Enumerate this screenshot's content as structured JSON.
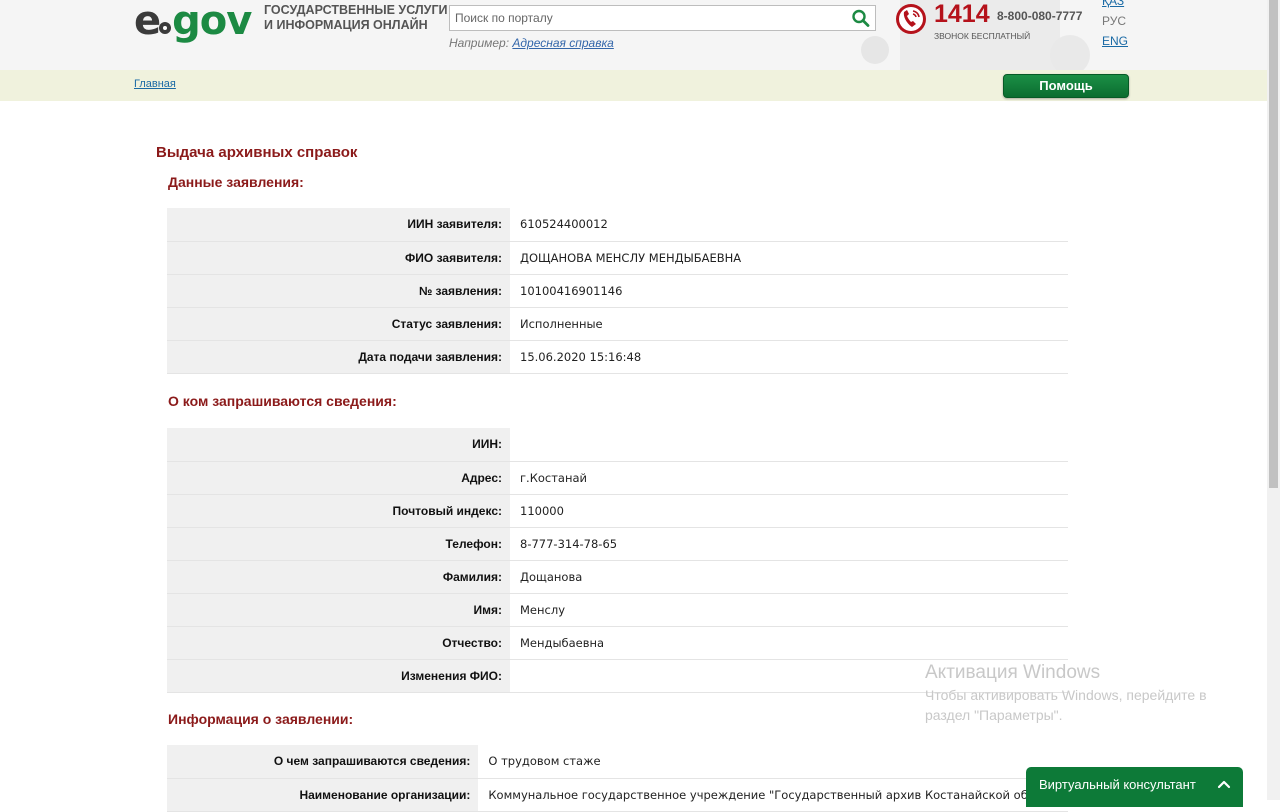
{
  "header": {
    "logo_left": "e",
    "logo_right": "gov",
    "tagline_line1": "ГОСУДАРСТВЕННЫЕ УСЛУГИ",
    "tagline_line2": "И ИНФОРМАЦИЯ ОНЛАЙН",
    "search": {
      "placeholder": "Поиск по порталу",
      "value": "",
      "hint_prefix": "Например: ",
      "hint_link": "Адресная справка"
    },
    "phone": {
      "short": "1414",
      "long": "8-800-080-7777",
      "free_label": "ЗВОНОК БЕСПЛАТНЫЙ"
    },
    "languages": [
      "ҚАЗ",
      "РУС",
      "ENG"
    ],
    "accent_color": "#1c8a43",
    "phone_color": "#b5121b"
  },
  "breadcrumb": {
    "home": "Главная",
    "help_button": "Помощь"
  },
  "page_title": "Выдача архивных справок",
  "sections": [
    {
      "title": "Данные заявления:",
      "rows": [
        {
          "label": "ИИН заявителя:",
          "value": "610524400012"
        },
        {
          "label": "ФИО заявителя:",
          "value": "ДОЩАНОВА МЕНСЛУ МЕНДЫБАЕВНА"
        },
        {
          "label": "№ заявления:",
          "value": "10100416901146"
        },
        {
          "label": "Статус заявления:",
          "value": "Исполненные"
        },
        {
          "label": "Дата подачи заявления:",
          "value": "15.06.2020 15:16:48"
        }
      ]
    },
    {
      "title": "О ком запрашиваются сведения:",
      "rows": [
        {
          "label": "ИИН:",
          "value": ""
        },
        {
          "label": "Адрес:",
          "value": "г.Костанай"
        },
        {
          "label": "Почтовый индекс:",
          "value": "110000"
        },
        {
          "label": "Телефон:",
          "value": "8-777-314-78-65"
        },
        {
          "label": "Фамилия:",
          "value": "Дощанова"
        },
        {
          "label": "Имя:",
          "value": "Менслу"
        },
        {
          "label": "Отчество:",
          "value": "Мендыбаевна"
        },
        {
          "label": "Изменения ФИО:",
          "value": ""
        }
      ]
    },
    {
      "title": "Информация о заявлении:",
      "rows": [
        {
          "label": "О чем запрашиваются сведения:",
          "value": "О трудовом стаже"
        },
        {
          "label": "Наименование организации:",
          "value": "Коммунальное государственное учреждение \"Государственный архив Костанайской области\""
        }
      ]
    }
  ],
  "windows_activation": {
    "title": "Активация Windows",
    "line1": "Чтобы активировать Windows, перейдите в",
    "line2": "раздел \"Параметры\"."
  },
  "consultant": {
    "label": "Виртуальный консультант"
  }
}
